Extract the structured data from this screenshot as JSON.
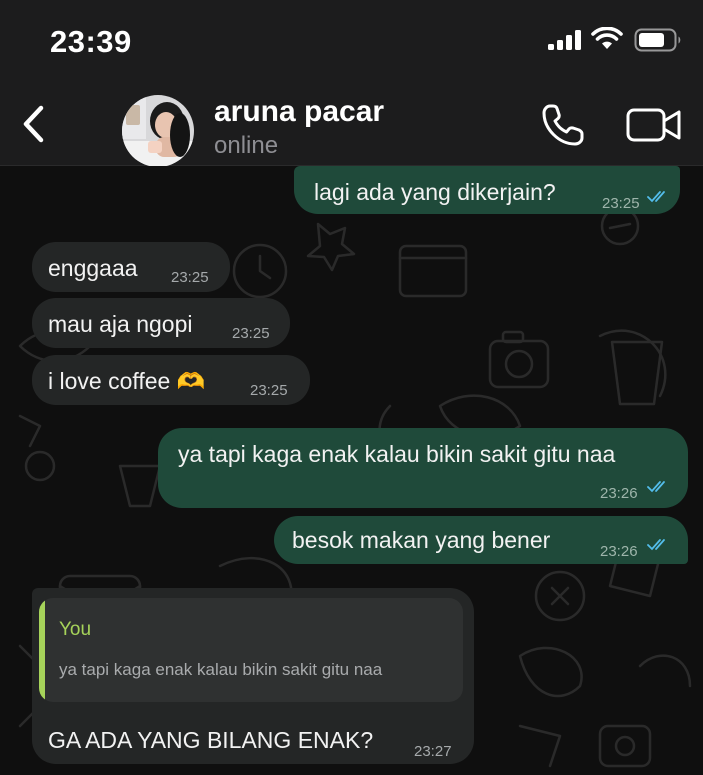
{
  "status_bar": {
    "time": "23:39"
  },
  "header": {
    "contact_name": "aruna pacar",
    "contact_status": "online"
  },
  "messages": [
    {
      "direction": "outgoing",
      "text": "lagi ada yang dikerjain?",
      "time": "23:25",
      "read": true
    },
    {
      "direction": "incoming",
      "text": "enggaaa",
      "time": "23:25"
    },
    {
      "direction": "incoming",
      "text": "mau aja ngopi",
      "time": "23:25"
    },
    {
      "direction": "incoming",
      "text": "i love coffee 🫶",
      "time": "23:25"
    },
    {
      "direction": "outgoing",
      "text": "ya tapi kaga enak kalau bikin sakit gitu naa",
      "time": "23:26",
      "read": true
    },
    {
      "direction": "outgoing",
      "text": "besok makan yang bener",
      "time": "23:26",
      "read": true
    },
    {
      "direction": "incoming",
      "quote": {
        "author": "You",
        "text": "ya tapi kaga enak kalau bikin sakit gitu naa"
      },
      "text": "GA ADA YANG BILANG ENAK?",
      "time": "23:27"
    }
  ],
  "colors": {
    "outgoing_bubble": "#1f4a3a",
    "incoming_bubble": "#242626",
    "read_ticks": "#53bdeb",
    "quote_accent": "#a6d35a"
  },
  "icons": [
    "signal-icon",
    "wifi-icon",
    "battery-icon",
    "back-chevron-icon",
    "phone-icon",
    "video-camera-icon",
    "double-check-icon"
  ]
}
